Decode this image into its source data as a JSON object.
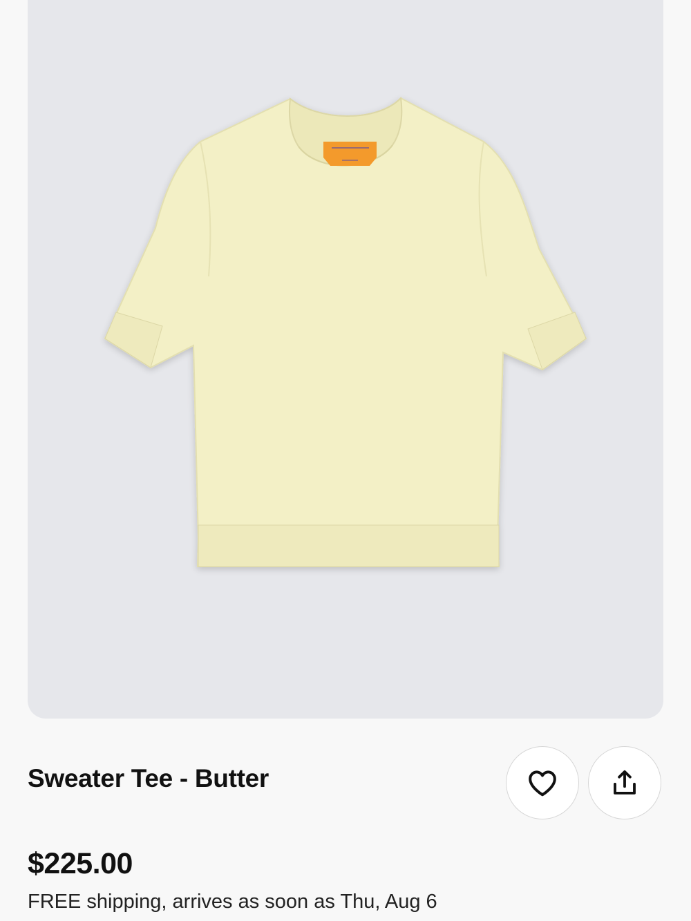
{
  "product": {
    "title": "Sweater Tee - Butter",
    "price": "$225.00",
    "shipping": "FREE shipping, arrives as soon as Thu, Aug 6",
    "image": {
      "garment_color": "#f3f0c6",
      "label_color": "#f39a2c",
      "background_color": "#e6e7eb"
    }
  },
  "actions": {
    "favorite_icon": "heart-icon",
    "share_icon": "share-icon"
  }
}
